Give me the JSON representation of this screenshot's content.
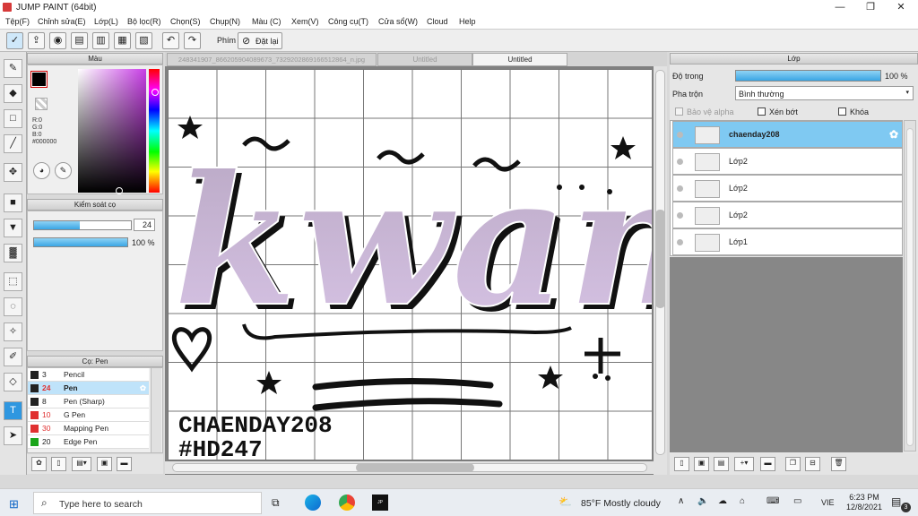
{
  "window": {
    "title": "JUMP PAINT (64bit)"
  },
  "menu": [
    "Tệp(F)",
    "Chỉnh sửa(E)",
    "Lớp(L)",
    "Bộ lọc(R)",
    "Chọn(S)",
    "Chụp(N)",
    "Màu (C)",
    "Xem(V)",
    "Công cụ(T)",
    "Cửa sổ(W)",
    "Cloud",
    "Help"
  ],
  "toolbar": {
    "phim_label": "Phím",
    "reset_label": "Đặt lại"
  },
  "color_panel": {
    "title": "Màu",
    "r": "R:0",
    "g": "G:0",
    "b": "B:0",
    "hex": "#000000",
    "primary": "#000000"
  },
  "brush_panel": {
    "title": "Kiểm soát cọ",
    "size": "24",
    "opacity": "100 %",
    "size_fraction": 0.47,
    "opacity_fraction": 1.0
  },
  "pen_panel": {
    "title": "Cọ: Pen",
    "items": [
      {
        "num": "3",
        "name": "Pencil",
        "color": "#222222"
      },
      {
        "num": "24",
        "name": "Pen",
        "color": "#222222",
        "selected": true
      },
      {
        "num": "8",
        "name": "Pen (Sharp)",
        "color": "#222222"
      },
      {
        "num": "10",
        "name": "G Pen",
        "color": "#e03030"
      },
      {
        "num": "30",
        "name": "Mapping Pen",
        "color": "#e03030"
      },
      {
        "num": "20",
        "name": "Edge Pen",
        "color": "#1aa51a"
      }
    ]
  },
  "tabs": [
    "248341907_866205904089673_7329202869166512864_n.jpg",
    "Untitled",
    "Untitled"
  ],
  "artwork": {
    "line1": "CHAENDAY208",
    "line2": "#HD247",
    "main": "kwan"
  },
  "layer_panel": {
    "title": "Lớp",
    "opacity_label": "Độ trong",
    "opacity_value": "100 %",
    "blend_label": "Pha trộn",
    "blend_value": "Bình thường",
    "protect_alpha": "Bảo vệ alpha",
    "clip": "Xén bớt",
    "lock": "Khóa",
    "layers": [
      {
        "name": "chaenday208",
        "selected": true
      },
      {
        "name": "Lớp2"
      },
      {
        "name": "Lớp2"
      },
      {
        "name": "Lớp2"
      },
      {
        "name": "Lớp1"
      }
    ]
  },
  "taskbar": {
    "search_placeholder": "Type here to search",
    "weather": "85°F  Mostly cloudy",
    "lang": "VIE",
    "time": "6:23 PM",
    "date": "12/8/2021",
    "notif": "3"
  }
}
